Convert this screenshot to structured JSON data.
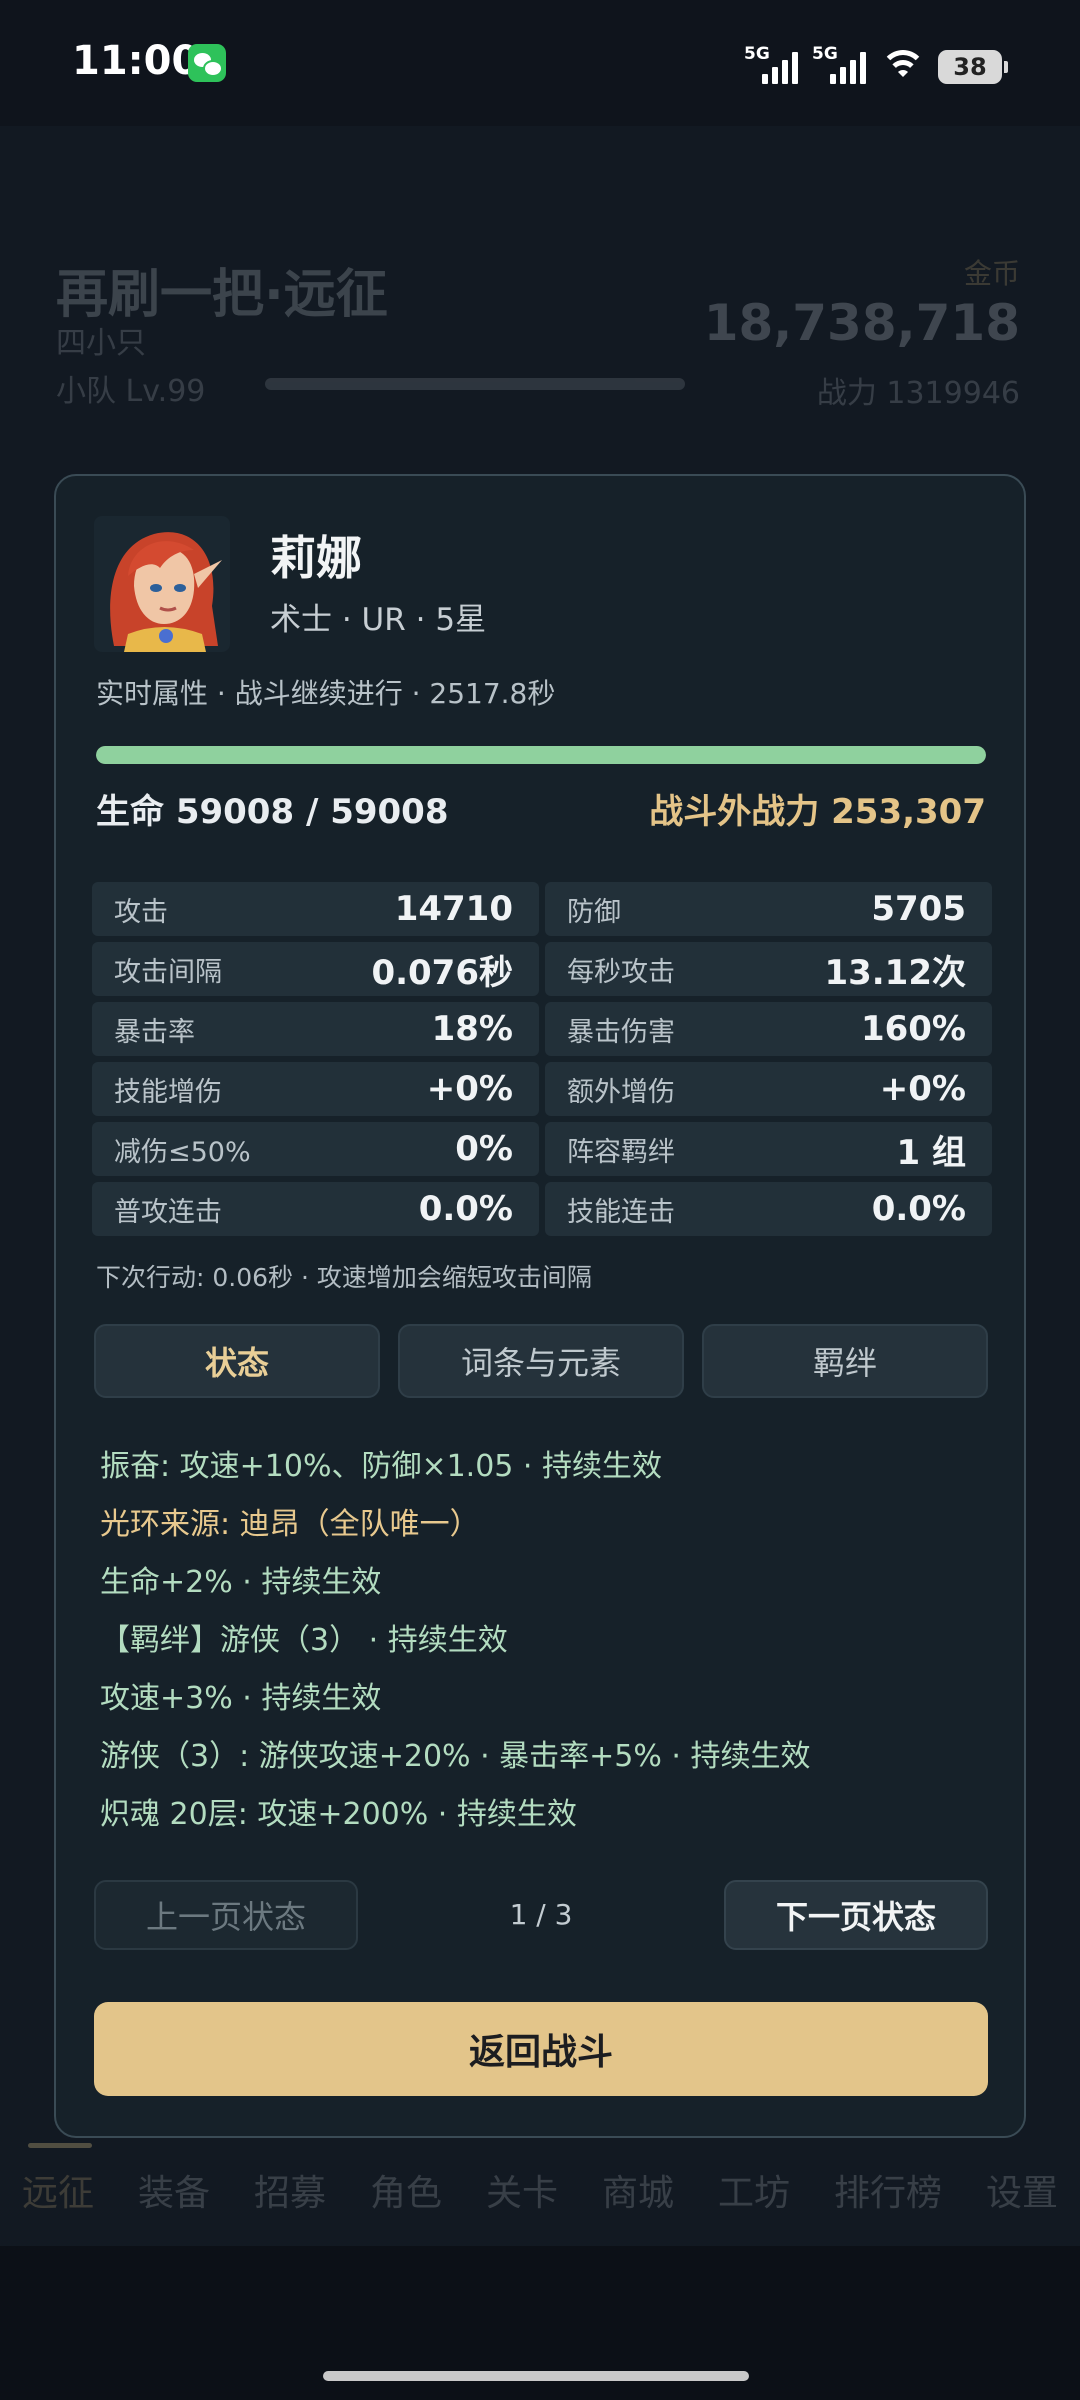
{
  "status_bar": {
    "time": "11:00",
    "signal1_label": "5G",
    "signal2_label": "5G",
    "battery": "38"
  },
  "background": {
    "title": "再刷一把·远征",
    "subtitle": "四小只",
    "team_level": "小队 Lv.99",
    "coin_label": "金币",
    "coins": "18,738,718",
    "power": "战力 1319946",
    "nav": [
      "远征",
      "装备",
      "招募",
      "角色",
      "关卡",
      "商城",
      "工坊",
      "排行榜",
      "设置"
    ]
  },
  "hero": {
    "name": "莉娜",
    "meta": "术士 · UR · 5星",
    "realtime": "实时属性 · 战斗继续进行 · 2517.8秒",
    "hp_fraction": 1.0,
    "hp_text": "生命 59008 / 59008",
    "outside_power": "战斗外战力 253,307"
  },
  "stats": [
    [
      {
        "k": "攻击",
        "v": "14710"
      },
      {
        "k": "防御",
        "v": "5705"
      }
    ],
    [
      {
        "k": "攻击间隔",
        "v": "0.076秒"
      },
      {
        "k": "每秒攻击",
        "v": "13.12次"
      }
    ],
    [
      {
        "k": "暴击率",
        "v": "18%"
      },
      {
        "k": "暴击伤害",
        "v": "160%"
      }
    ],
    [
      {
        "k": "技能增伤",
        "v": "+0%"
      },
      {
        "k": "额外增伤",
        "v": "+0%"
      }
    ],
    [
      {
        "k": "减伤≤50%",
        "v": "0%"
      },
      {
        "k": "阵容羁绊",
        "v": "1 组"
      }
    ],
    [
      {
        "k": "普攻连击",
        "v": "0.0%"
      },
      {
        "k": "技能连击",
        "v": "0.0%"
      }
    ]
  ],
  "next_action": "下次行动: 0.06秒 · 攻速增加会缩短攻击间隔",
  "tabs": [
    "状态",
    "词条与元素",
    "羁绊"
  ],
  "status_lines": [
    "振奋: 攻速+10%、防御×1.05 · 持续生效",
    "光环来源: 迪昂（全队唯一）",
    "生命+2% · 持续生效",
    "【羁绊】游侠（3） · 持续生效",
    "攻速+3% · 持续生效",
    "游侠（3）: 游侠攻速+20% · 暴击率+5% · 持续生效",
    "炽魂 20层: 攻速+200% · 持续生效"
  ],
  "pager": {
    "prev": "上一页状态",
    "page": "1 / 3",
    "next": "下一页状态"
  },
  "return_button": "返回战斗",
  "colors": {
    "accent_gold": "#e3c58a",
    "hp_green": "#8fd19e",
    "status_green": "#b3dcc0"
  }
}
